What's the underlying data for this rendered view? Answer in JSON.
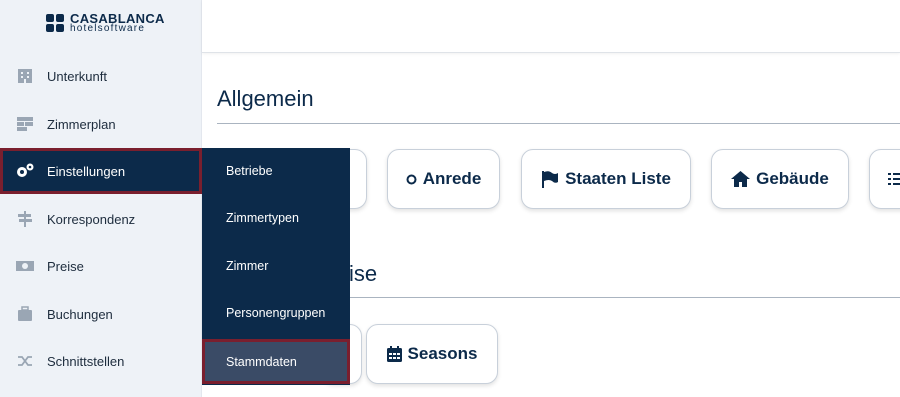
{
  "brand": {
    "title": "CASABLANCA",
    "subtitle": "hotelsoftware"
  },
  "sidebar": {
    "items": [
      {
        "label": "Unterkunft",
        "icon": "building-icon"
      },
      {
        "label": "Zimmerplan",
        "icon": "calendar-grid-icon"
      },
      {
        "label": "Einstellungen",
        "icon": "gears-icon",
        "active": true
      },
      {
        "label": "Korrespondenz",
        "icon": "signpost-icon"
      },
      {
        "label": "Preise",
        "icon": "money-icon"
      },
      {
        "label": "Buchungen",
        "icon": "suitcase-icon"
      },
      {
        "label": "Schnittstellen",
        "icon": "shuffle-icon"
      }
    ]
  },
  "submenu": {
    "items": [
      {
        "label": "Betriebe"
      },
      {
        "label": "Zimmertypen"
      },
      {
        "label": "Zimmer"
      },
      {
        "label": "Personengruppen"
      },
      {
        "label": "Stammdaten",
        "active": true
      }
    ]
  },
  "main": {
    "sections": [
      {
        "title": "Allgemein"
      },
      {
        "title": "ise"
      }
    ],
    "allgemein_cards": [
      {
        "label": "Anrede",
        "icon": "circle-icon"
      },
      {
        "label": "Staaten Liste",
        "icon": "flag-icon"
      },
      {
        "label": "Gebäude",
        "icon": "home-icon"
      }
    ],
    "preise_cards": [
      {
        "label": "Seasons",
        "icon": "calendar-icon"
      }
    ]
  },
  "colors": {
    "navy": "#0c2a4a",
    "highlight_border": "#7a1f2e",
    "sidebar_bg": "#eef2f7"
  }
}
